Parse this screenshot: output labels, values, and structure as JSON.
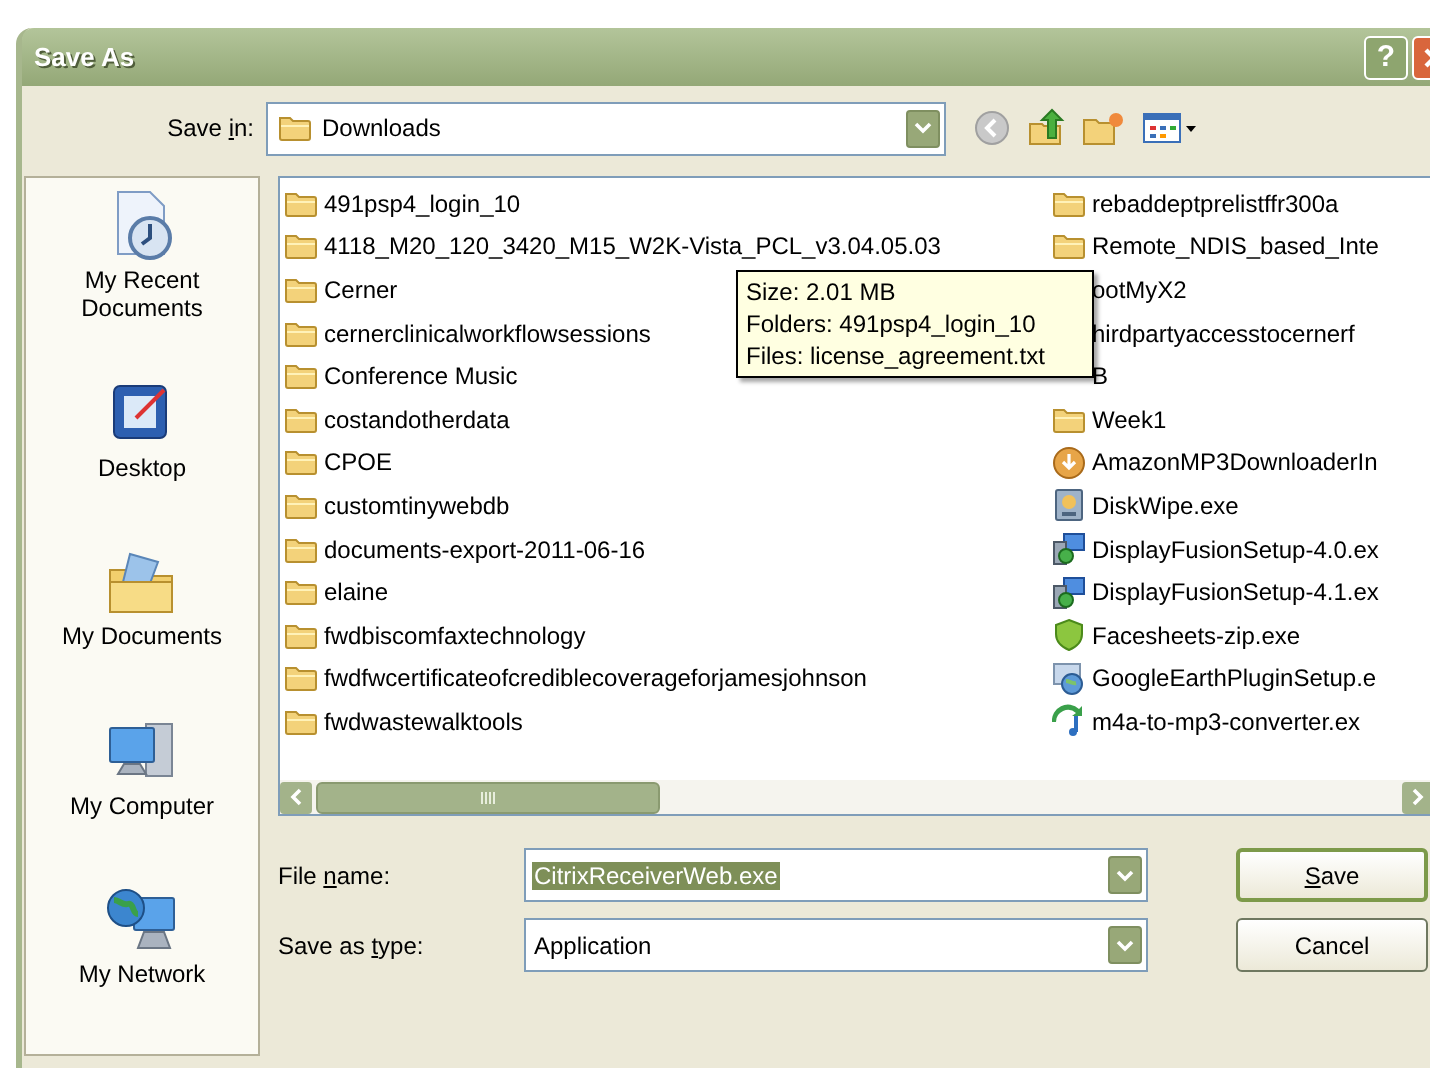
{
  "window": {
    "title": "Save As",
    "help": "?"
  },
  "save_in": {
    "label_parts": [
      {
        "text": "Save ",
        "underlined": false
      },
      {
        "text": "i",
        "underlined": true
      },
      {
        "text": "n:",
        "underlined": false
      }
    ],
    "value": "Downloads"
  },
  "places": [
    {
      "kind": "recent",
      "label": "My Recent Documents"
    },
    {
      "kind": "desktop",
      "label": "Desktop"
    },
    {
      "kind": "documents",
      "label": "My Documents"
    },
    {
      "kind": "computer",
      "label": "My Computer"
    },
    {
      "kind": "network",
      "label": "My Network"
    }
  ],
  "files": {
    "column_1": [
      {
        "kind": "folder",
        "name": "491psp4_login_10"
      },
      {
        "kind": "folder",
        "name": "4118_M20_120_3420_M15_W2K-Vista_PCL_v3.04.05.03"
      },
      {
        "kind": "folder",
        "name": "Cerner"
      },
      {
        "kind": "folder",
        "name": "cernerclinicalworkflowsessions"
      },
      {
        "kind": "folder",
        "name": "Conference Music"
      },
      {
        "kind": "folder",
        "name": "costandotherdata"
      },
      {
        "kind": "folder",
        "name": "CPOE"
      },
      {
        "kind": "folder",
        "name": "customtinywebdb"
      },
      {
        "kind": "folder",
        "name": "documents-export-2011-06-16"
      },
      {
        "kind": "folder",
        "name": "elaine"
      },
      {
        "kind": "folder",
        "name": "fwdbiscomfaxtechnology"
      },
      {
        "kind": "folder",
        "name": "fwdfwcertificateofcrediblecoverageforjamesjohnson"
      },
      {
        "kind": "folder",
        "name": "fwdwastewalktools"
      }
    ],
    "column_2": [
      {
        "kind": "folder",
        "name": "rebaddeptprelistffr300a"
      },
      {
        "kind": "folder",
        "name": "Remote_NDIS_based_Inte"
      },
      {
        "kind": "covered",
        "name": "ootMyX2"
      },
      {
        "kind": "covered",
        "name": "hirdpartyaccesstocernerf"
      },
      {
        "kind": "covered",
        "name": "B"
      },
      {
        "kind": "folder",
        "name": "Week1"
      },
      {
        "kind": "download",
        "name": "AmazonMP3DownloaderIn"
      },
      {
        "kind": "disk",
        "name": "DiskWipe.exe"
      },
      {
        "kind": "setup",
        "name": "DisplayFusionSetup-4.0.ex"
      },
      {
        "kind": "setup",
        "name": "DisplayFusionSetup-4.1.ex"
      },
      {
        "kind": "shield",
        "name": "Facesheets-zip.exe"
      },
      {
        "kind": "globe",
        "name": "GoogleEarthPluginSetup.e"
      },
      {
        "kind": "converter",
        "name": "m4a-to-mp3-converter.ex"
      }
    ]
  },
  "tooltip": [
    "Size: 2.01 MB",
    "Folders: 491psp4_login_10",
    "Files: license_agreement.txt"
  ],
  "file_name": {
    "label_parts": [
      {
        "text": "File ",
        "underlined": false
      },
      {
        "text": "n",
        "underlined": true
      },
      {
        "text": "ame:",
        "underlined": false
      }
    ],
    "value": "CitrixReceiverWeb.exe",
    "selected": true
  },
  "save_as_type": {
    "label_parts": [
      {
        "text": "Save as ",
        "underlined": false
      },
      {
        "text": "t",
        "underlined": true
      },
      {
        "text": "ype:",
        "underlined": false
      }
    ],
    "value": "Application"
  },
  "buttons": [
    {
      "label_parts": [
        {
          "text": "S",
          "underlined": true
        },
        {
          "text": "ave",
          "underlined": false
        }
      ],
      "default": true
    },
    {
      "label_parts": [
        {
          "text": "Cancel",
          "underlined": false
        }
      ],
      "default": false
    }
  ]
}
